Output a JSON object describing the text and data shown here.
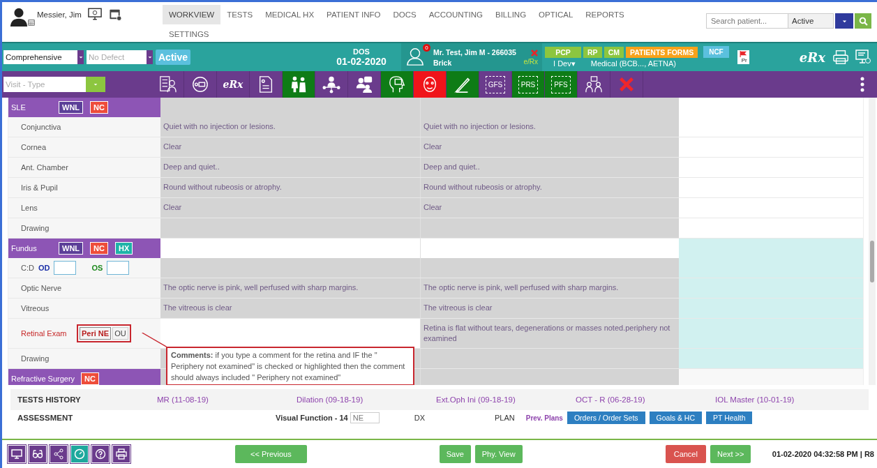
{
  "user": {
    "name": "Messier, Jim"
  },
  "nav": [
    {
      "label": "WORKVIEW",
      "selected": true
    },
    {
      "label": "TESTS",
      "selected": false
    },
    {
      "label": "MEDICAL HX",
      "selected": false
    },
    {
      "label": "PATIENT INFO",
      "selected": false
    },
    {
      "label": "DOCS",
      "selected": false
    },
    {
      "label": "ACCOUNTING",
      "selected": false
    },
    {
      "label": "BILLING",
      "selected": false
    },
    {
      "label": "OPTICAL",
      "selected": false
    },
    {
      "label": "REPORTS",
      "selected": false
    },
    {
      "label": "SETTINGS",
      "selected": false
    }
  ],
  "search": {
    "placeholder": "Search patient...",
    "status": "Active"
  },
  "visit": {
    "template": "Comprehensive",
    "defect_placeholder": "No Defect",
    "status": "Active",
    "dos_label": "DOS",
    "dos": "01-02-2020",
    "alert_count": "0",
    "patient": "Mr. Test, Jim M - 266035",
    "location": "Brick",
    "erx_link": "e/Rx",
    "tags": [
      {
        "label": "PCP",
        "color": "#8cc63f"
      },
      {
        "label": "RP",
        "color": "#8cc63f"
      },
      {
        "label": "CM",
        "color": "#8cc63f"
      },
      {
        "label": "PATIENTS FORMS",
        "color": "#f7a21b"
      }
    ],
    "provider": "I Dev▾",
    "insurance": "Medical (BCB..., AETNA)",
    "ncf": "NCF",
    "flag_label": "Pr",
    "erx_logo": "eRx"
  },
  "visit_type": {
    "placeholder": "Visit - Type"
  },
  "toolbar": [
    {
      "color": "#6a3b8c"
    },
    {
      "color": "#6a3b8c"
    },
    {
      "label": "eRx",
      "color": "#6a3b8c"
    },
    {
      "color": "#6a3b8c"
    },
    {
      "color": "#0e7c16"
    },
    {
      "color": "#6a3b8c"
    },
    {
      "color": "#6a3b8c"
    },
    {
      "color": "#0e7c16"
    },
    {
      "color": "#f0141a"
    },
    {
      "color": "#0e7c16"
    },
    {
      "label": "GFS",
      "color": "#6a3b8c"
    },
    {
      "label": "PRS",
      "color": "#0e7c16"
    },
    {
      "label": "PFS",
      "color": "#0e7c16"
    },
    {
      "color": "#6a3b8c"
    },
    {
      "color": "#6a3b8c"
    }
  ],
  "sections": [
    {
      "title": "SLE",
      "buttons": [
        {
          "label": "WNL",
          "kind": "wnl"
        },
        {
          "label": "NC",
          "kind": "nc"
        }
      ],
      "highlighted": false,
      "rows": [
        {
          "label": "Conjunctiva",
          "od": "Quiet with no injection or lesions.",
          "os": "Quiet with no injection or lesions."
        },
        {
          "label": "Cornea",
          "od": "Clear",
          "os": "Clear"
        },
        {
          "label": "Ant. Chamber",
          "od": "Deep and quiet..",
          "os": "Deep and quiet.."
        },
        {
          "label": "Iris & Pupil",
          "od": "Round without rubeosis or atrophy.",
          "os": "Round without rubeosis or atrophy."
        },
        {
          "label": "Lens",
          "od": "Clear",
          "os": "Clear"
        },
        {
          "label": "Drawing"
        }
      ]
    },
    {
      "title": "Fundus",
      "buttons": [
        {
          "label": "WNL",
          "kind": "wnl"
        },
        {
          "label": "NC",
          "kind": "nc"
        },
        {
          "label": "HX",
          "kind": "hx"
        }
      ],
      "highlighted": true,
      "rows": [
        {
          "label": "C:D",
          "kind": "cd",
          "fields": [
            {
              "label": "OD",
              "color": "#1b2fa8"
            },
            {
              "label": "OS",
              "color": "#1f8a1f"
            }
          ]
        },
        {
          "label": "Optic Nerve",
          "od": "The optic nerve is pink, well perfused with sharp margins.",
          "os": "The optic nerve is pink, well perfused with sharp margins."
        },
        {
          "label": "Vitreous",
          "od": "The vitreous is clear",
          "os": "The vitreous is clear"
        },
        {
          "label": "Retinal Exam",
          "kind": "options",
          "flagged": true,
          "options": [
            {
              "label": "Peri NE",
              "selected": true
            },
            {
              "label": "OU",
              "selected": false
            }
          ],
          "os": "Retina is flat without tears, degenerations or masses noted.periphery not examined",
          "comment": "**Comments:** if you type a comment for the retina and IF the \" Periphery not examined\" is checked or highlighted then the comment should always included \" Periphery not examined\""
        },
        {
          "label": "Drawing"
        }
      ]
    },
    {
      "title": "Refractive Surgery",
      "buttons": [
        {
          "label": "NC",
          "kind": "nc"
        }
      ],
      "highlighted": false
    }
  ],
  "tests_history": {
    "title": "TESTS HISTORY",
    "items": [
      "MR (11-08-19)",
      "Dilation (09-18-19)",
      "Ext.Oph Ini (09-18-19)",
      "OCT - R (06-28-19)",
      "IOL Master (10-01-19)"
    ]
  },
  "assessment": {
    "title": "ASSESSMENT",
    "visual_function": "Visual Function - 14",
    "vf_value": "NE",
    "dx": "DX",
    "plan": "PLAN",
    "prev_plans": "Prev. Plans",
    "buttons": [
      "Orders / Order Sets",
      "Goals & HC",
      "PT Health"
    ]
  },
  "footer": {
    "previous": "<< Previous",
    "save": "Save",
    "phy_view": "Phy. View",
    "cancel": "Cancel",
    "next": "Next >>",
    "timestamp": "01-02-2020 04:32:58 PM | R8"
  }
}
